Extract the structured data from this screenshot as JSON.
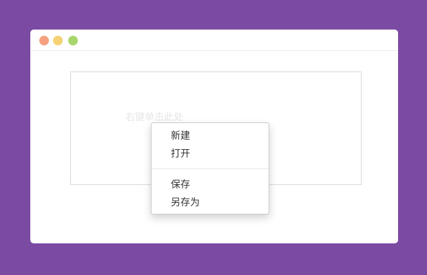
{
  "window": {
    "controls": [
      {
        "name": "close",
        "color": "#f5a180"
      },
      {
        "name": "minimize",
        "color": "#f5d273"
      },
      {
        "name": "maximize",
        "color": "#a8d66c"
      }
    ]
  },
  "target": {
    "hint": "右键单击此处"
  },
  "context_menu": {
    "items": [
      {
        "label": "新建"
      },
      {
        "label": "打开"
      },
      {
        "label": "保存"
      },
      {
        "label": "另存为"
      }
    ]
  },
  "colors": {
    "background": "#7b4aa3",
    "window": "#ffffff",
    "menu_text": "#333333"
  }
}
